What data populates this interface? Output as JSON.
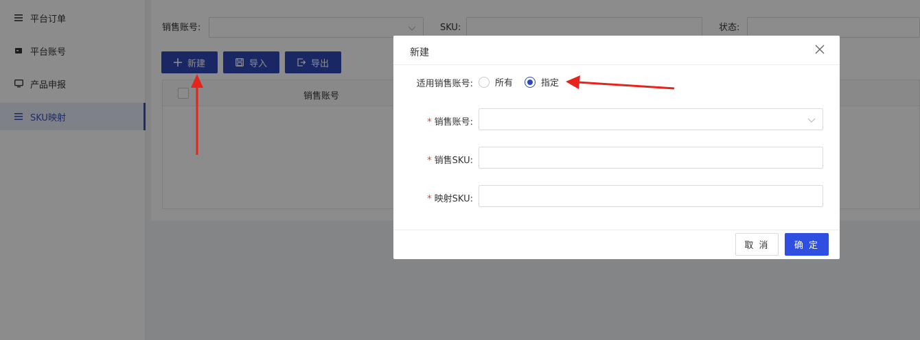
{
  "sidebar": {
    "items": [
      {
        "label": "平台订单",
        "icon": "list-icon"
      },
      {
        "label": "平台账号",
        "icon": "card-icon"
      },
      {
        "label": "产品申报",
        "icon": "monitor-icon"
      },
      {
        "label": "SKU映射",
        "icon": "list-icon",
        "active": true
      }
    ]
  },
  "filters": {
    "account_label": "销售账号:",
    "sku_label": "SKU:",
    "status_label": "状态:"
  },
  "toolbar": {
    "new_label": "新建",
    "import_label": "导入",
    "export_label": "导出"
  },
  "table": {
    "columns": [
      "销售账号"
    ]
  },
  "modal": {
    "title": "新建",
    "scope_label": "适用销售账号:",
    "scope_options": [
      "所有",
      "指定"
    ],
    "scope_selected": "指定",
    "account_label": "销售账号:",
    "sales_sku_label": "销售SKU:",
    "mapped_sku_label": "映射SKU:",
    "required_mark": "*",
    "cancel_label": "取 消",
    "ok_label": "确 定"
  },
  "colors": {
    "primary": "#2e47b8",
    "ok_button": "#2e4fe0",
    "annotation_arrow": "#e8231b"
  }
}
